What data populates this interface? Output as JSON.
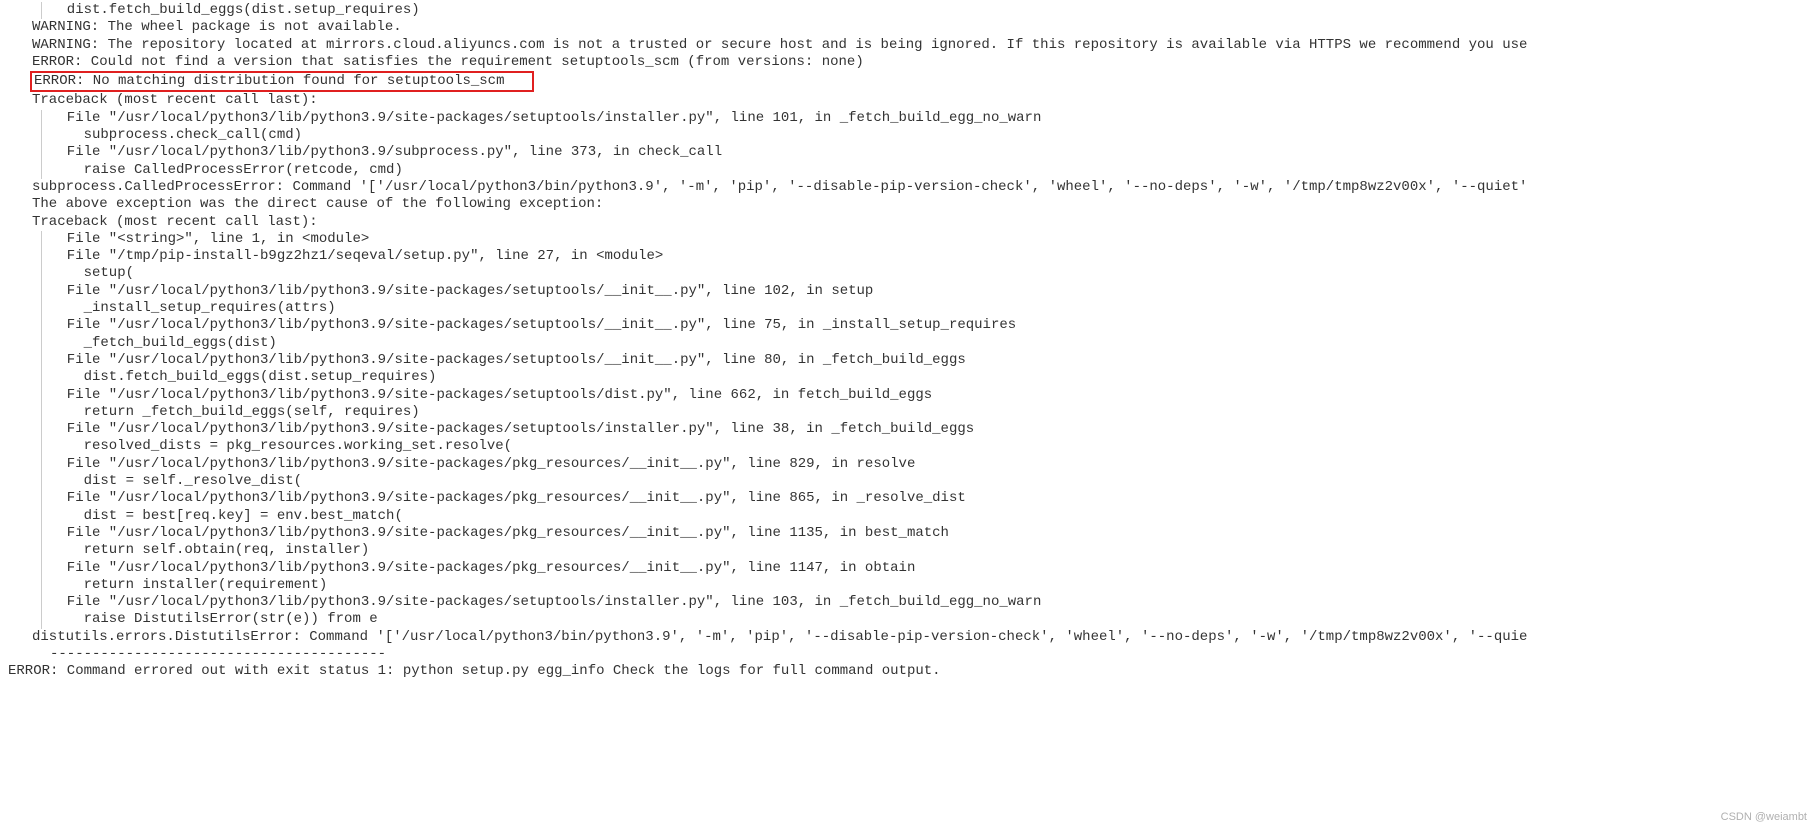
{
  "lines": {
    "l1": "  dist.fetch_build_eggs(dist.setup_requires)",
    "l2": "WARNING: The wheel package is not available.",
    "l3": "WARNING: The repository located at mirrors.cloud.aliyuncs.com is not a trusted or secure host and is being ignored. If this repository is available via HTTPS we recommend you use",
    "l4": "ERROR: Could not find a version that satisfies the requirement setuptools_scm (from versions: none)",
    "l5": "ERROR: No matching distribution found for setuptools_scm",
    "l5_pad": "   ",
    "l6": "Traceback (most recent call last):",
    "l7": "  File \"/usr/local/python3/lib/python3.9/site-packages/setuptools/installer.py\", line 101, in _fetch_build_egg_no_warn",
    "l8": "    subprocess.check_call(cmd)",
    "l9": "  File \"/usr/local/python3/lib/python3.9/subprocess.py\", line 373, in check_call",
    "l10": "    raise CalledProcessError(retcode, cmd)",
    "l11": "subprocess.CalledProcessError: Command '['/usr/local/python3/bin/python3.9', '-m', 'pip', '--disable-pip-version-check', 'wheel', '--no-deps', '-w', '/tmp/tmp8wz2v00x', '--quiet'",
    "l12": "",
    "l13": "The above exception was the direct cause of the following exception:",
    "l14": "",
    "l15": "Traceback (most recent call last):",
    "l16": "  File \"<string>\", line 1, in <module>",
    "l17": "  File \"/tmp/pip-install-b9gz2hz1/seqeval/setup.py\", line 27, in <module>",
    "l18": "    setup(",
    "l19": "  File \"/usr/local/python3/lib/python3.9/site-packages/setuptools/__init__.py\", line 102, in setup",
    "l20": "    _install_setup_requires(attrs)",
    "l21": "  File \"/usr/local/python3/lib/python3.9/site-packages/setuptools/__init__.py\", line 75, in _install_setup_requires",
    "l22": "    _fetch_build_eggs(dist)",
    "l23": "  File \"/usr/local/python3/lib/python3.9/site-packages/setuptools/__init__.py\", line 80, in _fetch_build_eggs",
    "l24": "    dist.fetch_build_eggs(dist.setup_requires)",
    "l25": "  File \"/usr/local/python3/lib/python3.9/site-packages/setuptools/dist.py\", line 662, in fetch_build_eggs",
    "l26": "    return _fetch_build_eggs(self, requires)",
    "l27": "  File \"/usr/local/python3/lib/python3.9/site-packages/setuptools/installer.py\", line 38, in _fetch_build_eggs",
    "l28": "    resolved_dists = pkg_resources.working_set.resolve(",
    "l29": "  File \"/usr/local/python3/lib/python3.9/site-packages/pkg_resources/__init__.py\", line 829, in resolve",
    "l30": "    dist = self._resolve_dist(",
    "l31": "  File \"/usr/local/python3/lib/python3.9/site-packages/pkg_resources/__init__.py\", line 865, in _resolve_dist",
    "l32": "    dist = best[req.key] = env.best_match(",
    "l33": "  File \"/usr/local/python3/lib/python3.9/site-packages/pkg_resources/__init__.py\", line 1135, in best_match",
    "l34": "    return self.obtain(req, installer)",
    "l35": "  File \"/usr/local/python3/lib/python3.9/site-packages/pkg_resources/__init__.py\", line 1147, in obtain",
    "l36": "    return installer(requirement)",
    "l37": "  File \"/usr/local/python3/lib/python3.9/site-packages/setuptools/installer.py\", line 103, in _fetch_build_egg_no_warn",
    "l38": "    raise DistutilsError(str(e)) from e",
    "l39": "distutils.errors.DistutilsError: Command '['/usr/local/python3/bin/python3.9', '-m', 'pip', '--disable-pip-version-check', 'wheel', '--no-deps', '-w', '/tmp/tmp8wz2v00x', '--quie",
    "dashes": "----------------------------------------",
    "final": "ERROR: Command errored out with exit status 1: python setup.py egg_info Check the logs for full command output."
  },
  "watermark": "CSDN @weiambt"
}
